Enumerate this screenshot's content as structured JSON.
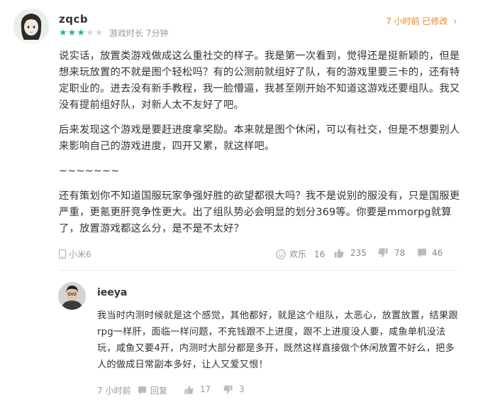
{
  "comment": {
    "username": "zqcb",
    "rating": 3,
    "rating_max": 5,
    "playtime": "游戏时长 7分钟",
    "time_edited": "7 小时前 已修改",
    "paragraphs": [
      "说实话，放置类游戏做成这么重社交的样子。我是第一次看到，觉得还是挺新颖的，但是想来玩放置的不就是图个轻松吗？有的公测前就组好了队，有的游戏里要三卡的，还有特定职业的。进去没有新手教程，我一脸懵逼，我甚至刚开始不知道这游戏还要组队。我又没有提前组好队，对新人太不友好了吧。",
      "后来发现这个游戏是要赶进度拿奖励。本来就是图个休闲，可以有社交，但是不想要别人来影响自己的游戏进度，四开又累，就这样吧。",
      "~~~~~~~",
      "还有策划你不知道国服玩家争强好胜的欲望都很大吗？我不是说别的服没有，只是国服更严重，更氪更肝竞争性更大。出了组队势必会明显的划分369等。你要是mmorpg就算了，放置游戏都这么分，是不是不太好？"
    ],
    "device": "小米6",
    "actions": {
      "happy_label": "欢乐",
      "happy_count": "16",
      "like_count": "235",
      "dislike_count": "78",
      "reply_count": "46"
    }
  },
  "reply": {
    "username": "ieeya",
    "text": "我当时内测时候就是这个感觉，其他都好，就是这个组队，太恶心，放置放置，结果跟rpg一样肝，面临一样问题，不充钱跟不上进度，跟不上进度没人要，咸鱼单机没法玩，咸鱼又要4开，内测时大部分都是多开，既然这样直接做个休闲放置不好么，把多人的做成日常副本多好，让人又爱又恨！",
    "time": "7 小时前",
    "reply_label": "回复",
    "like_count": "17",
    "dislike_count": "3"
  },
  "colors": {
    "accent_teal": "#1fb2a6",
    "time_orange": "#f08519",
    "muted_gray": "#999999"
  }
}
